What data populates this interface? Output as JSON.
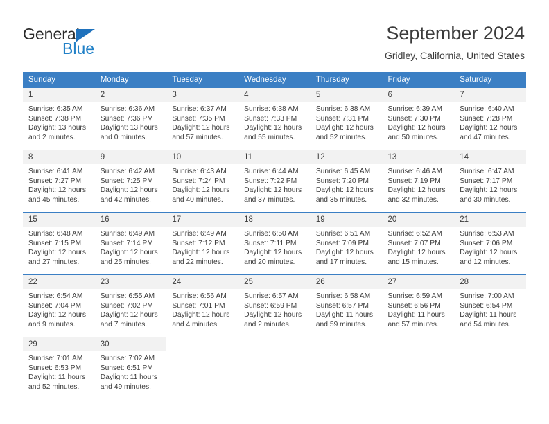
{
  "brand": {
    "name_dark": "General",
    "name_blue": "Blue",
    "accent_color": "#2281c7",
    "triangle_color": "#1f72bd"
  },
  "header": {
    "title": "September 2024",
    "subtitle": "Gridley, California, United States"
  },
  "calendar": {
    "header_bg": "#3b7fc4",
    "daynum_bg": "#f2f2f2",
    "weekdays": [
      "Sunday",
      "Monday",
      "Tuesday",
      "Wednesday",
      "Thursday",
      "Friday",
      "Saturday"
    ],
    "weeks": [
      [
        {
          "day": "1",
          "sunrise": "Sunrise: 6:35 AM",
          "sunset": "Sunset: 7:38 PM",
          "daylight1": "Daylight: 13 hours",
          "daylight2": "and 2 minutes."
        },
        {
          "day": "2",
          "sunrise": "Sunrise: 6:36 AM",
          "sunset": "Sunset: 7:36 PM",
          "daylight1": "Daylight: 13 hours",
          "daylight2": "and 0 minutes."
        },
        {
          "day": "3",
          "sunrise": "Sunrise: 6:37 AM",
          "sunset": "Sunset: 7:35 PM",
          "daylight1": "Daylight: 12 hours",
          "daylight2": "and 57 minutes."
        },
        {
          "day": "4",
          "sunrise": "Sunrise: 6:38 AM",
          "sunset": "Sunset: 7:33 PM",
          "daylight1": "Daylight: 12 hours",
          "daylight2": "and 55 minutes."
        },
        {
          "day": "5",
          "sunrise": "Sunrise: 6:38 AM",
          "sunset": "Sunset: 7:31 PM",
          "daylight1": "Daylight: 12 hours",
          "daylight2": "and 52 minutes."
        },
        {
          "day": "6",
          "sunrise": "Sunrise: 6:39 AM",
          "sunset": "Sunset: 7:30 PM",
          "daylight1": "Daylight: 12 hours",
          "daylight2": "and 50 minutes."
        },
        {
          "day": "7",
          "sunrise": "Sunrise: 6:40 AM",
          "sunset": "Sunset: 7:28 PM",
          "daylight1": "Daylight: 12 hours",
          "daylight2": "and 47 minutes."
        }
      ],
      [
        {
          "day": "8",
          "sunrise": "Sunrise: 6:41 AM",
          "sunset": "Sunset: 7:27 PM",
          "daylight1": "Daylight: 12 hours",
          "daylight2": "and 45 minutes."
        },
        {
          "day": "9",
          "sunrise": "Sunrise: 6:42 AM",
          "sunset": "Sunset: 7:25 PM",
          "daylight1": "Daylight: 12 hours",
          "daylight2": "and 42 minutes."
        },
        {
          "day": "10",
          "sunrise": "Sunrise: 6:43 AM",
          "sunset": "Sunset: 7:24 PM",
          "daylight1": "Daylight: 12 hours",
          "daylight2": "and 40 minutes."
        },
        {
          "day": "11",
          "sunrise": "Sunrise: 6:44 AM",
          "sunset": "Sunset: 7:22 PM",
          "daylight1": "Daylight: 12 hours",
          "daylight2": "and 37 minutes."
        },
        {
          "day": "12",
          "sunrise": "Sunrise: 6:45 AM",
          "sunset": "Sunset: 7:20 PM",
          "daylight1": "Daylight: 12 hours",
          "daylight2": "and 35 minutes."
        },
        {
          "day": "13",
          "sunrise": "Sunrise: 6:46 AM",
          "sunset": "Sunset: 7:19 PM",
          "daylight1": "Daylight: 12 hours",
          "daylight2": "and 32 minutes."
        },
        {
          "day": "14",
          "sunrise": "Sunrise: 6:47 AM",
          "sunset": "Sunset: 7:17 PM",
          "daylight1": "Daylight: 12 hours",
          "daylight2": "and 30 minutes."
        }
      ],
      [
        {
          "day": "15",
          "sunrise": "Sunrise: 6:48 AM",
          "sunset": "Sunset: 7:15 PM",
          "daylight1": "Daylight: 12 hours",
          "daylight2": "and 27 minutes."
        },
        {
          "day": "16",
          "sunrise": "Sunrise: 6:49 AM",
          "sunset": "Sunset: 7:14 PM",
          "daylight1": "Daylight: 12 hours",
          "daylight2": "and 25 minutes."
        },
        {
          "day": "17",
          "sunrise": "Sunrise: 6:49 AM",
          "sunset": "Sunset: 7:12 PM",
          "daylight1": "Daylight: 12 hours",
          "daylight2": "and 22 minutes."
        },
        {
          "day": "18",
          "sunrise": "Sunrise: 6:50 AM",
          "sunset": "Sunset: 7:11 PM",
          "daylight1": "Daylight: 12 hours",
          "daylight2": "and 20 minutes."
        },
        {
          "day": "19",
          "sunrise": "Sunrise: 6:51 AM",
          "sunset": "Sunset: 7:09 PM",
          "daylight1": "Daylight: 12 hours",
          "daylight2": "and 17 minutes."
        },
        {
          "day": "20",
          "sunrise": "Sunrise: 6:52 AM",
          "sunset": "Sunset: 7:07 PM",
          "daylight1": "Daylight: 12 hours",
          "daylight2": "and 15 minutes."
        },
        {
          "day": "21",
          "sunrise": "Sunrise: 6:53 AM",
          "sunset": "Sunset: 7:06 PM",
          "daylight1": "Daylight: 12 hours",
          "daylight2": "and 12 minutes."
        }
      ],
      [
        {
          "day": "22",
          "sunrise": "Sunrise: 6:54 AM",
          "sunset": "Sunset: 7:04 PM",
          "daylight1": "Daylight: 12 hours",
          "daylight2": "and 9 minutes."
        },
        {
          "day": "23",
          "sunrise": "Sunrise: 6:55 AM",
          "sunset": "Sunset: 7:02 PM",
          "daylight1": "Daylight: 12 hours",
          "daylight2": "and 7 minutes."
        },
        {
          "day": "24",
          "sunrise": "Sunrise: 6:56 AM",
          "sunset": "Sunset: 7:01 PM",
          "daylight1": "Daylight: 12 hours",
          "daylight2": "and 4 minutes."
        },
        {
          "day": "25",
          "sunrise": "Sunrise: 6:57 AM",
          "sunset": "Sunset: 6:59 PM",
          "daylight1": "Daylight: 12 hours",
          "daylight2": "and 2 minutes."
        },
        {
          "day": "26",
          "sunrise": "Sunrise: 6:58 AM",
          "sunset": "Sunset: 6:57 PM",
          "daylight1": "Daylight: 11 hours",
          "daylight2": "and 59 minutes."
        },
        {
          "day": "27",
          "sunrise": "Sunrise: 6:59 AM",
          "sunset": "Sunset: 6:56 PM",
          "daylight1": "Daylight: 11 hours",
          "daylight2": "and 57 minutes."
        },
        {
          "day": "28",
          "sunrise": "Sunrise: 7:00 AM",
          "sunset": "Sunset: 6:54 PM",
          "daylight1": "Daylight: 11 hours",
          "daylight2": "and 54 minutes."
        }
      ],
      [
        {
          "day": "29",
          "sunrise": "Sunrise: 7:01 AM",
          "sunset": "Sunset: 6:53 PM",
          "daylight1": "Daylight: 11 hours",
          "daylight2": "and 52 minutes."
        },
        {
          "day": "30",
          "sunrise": "Sunrise: 7:02 AM",
          "sunset": "Sunset: 6:51 PM",
          "daylight1": "Daylight: 11 hours",
          "daylight2": "and 49 minutes."
        },
        {
          "day": "",
          "sunrise": "",
          "sunset": "",
          "daylight1": "",
          "daylight2": ""
        },
        {
          "day": "",
          "sunrise": "",
          "sunset": "",
          "daylight1": "",
          "daylight2": ""
        },
        {
          "day": "",
          "sunrise": "",
          "sunset": "",
          "daylight1": "",
          "daylight2": ""
        },
        {
          "day": "",
          "sunrise": "",
          "sunset": "",
          "daylight1": "",
          "daylight2": ""
        },
        {
          "day": "",
          "sunrise": "",
          "sunset": "",
          "daylight1": "",
          "daylight2": ""
        }
      ]
    ]
  }
}
